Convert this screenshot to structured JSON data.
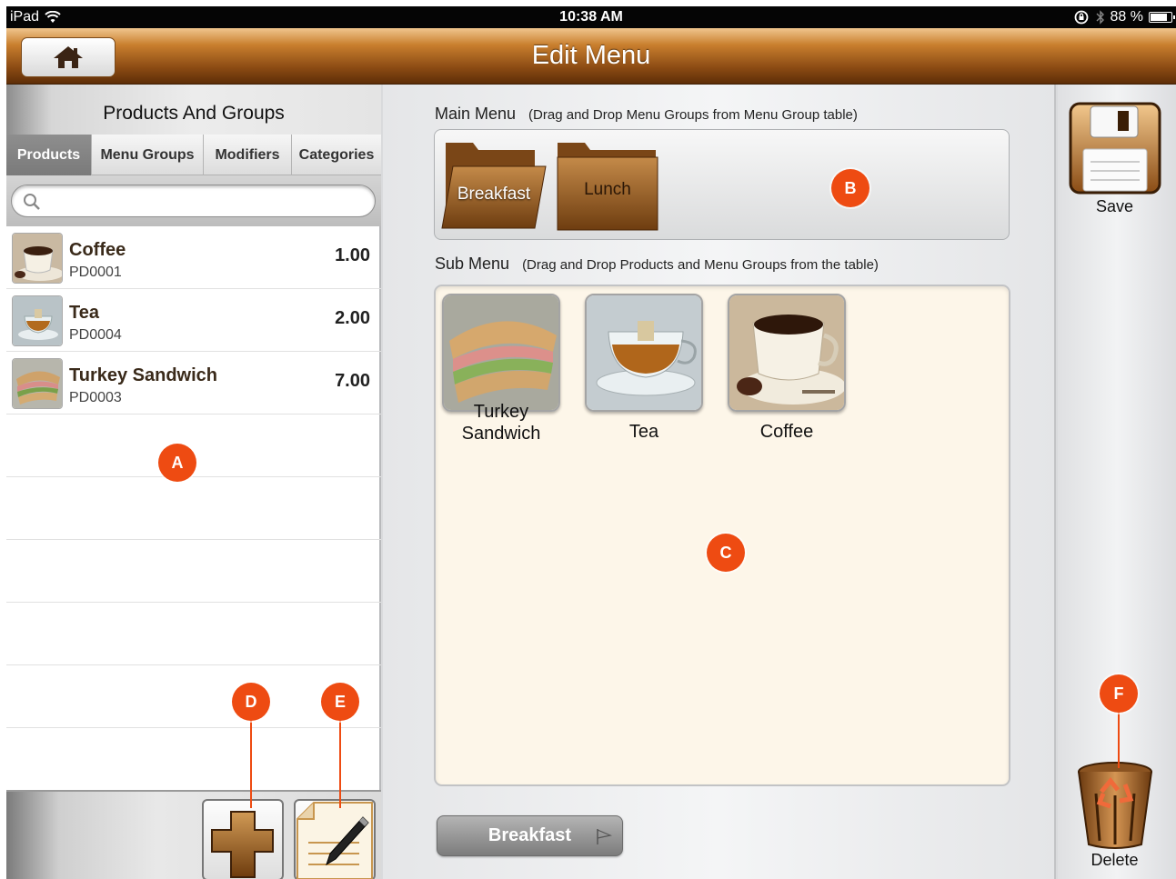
{
  "status_bar": {
    "device": "iPad",
    "time": "10:38 AM",
    "battery": "88 %",
    "battery_level": 0.88
  },
  "title_bar": {
    "title": "Edit Menu",
    "home_icon": "home-icon"
  },
  "left_panel": {
    "title": "Products And Groups",
    "tabs": [
      {
        "label": "Products",
        "active": true
      },
      {
        "label": "Menu Groups",
        "active": false
      },
      {
        "label": "Modifiers",
        "active": false
      },
      {
        "label": "Categories",
        "active": false
      }
    ],
    "search": {
      "placeholder": "",
      "value": ""
    },
    "products": [
      {
        "name": "Coffee",
        "code": "PD0001",
        "price": "1.00",
        "image": "coffee-image"
      },
      {
        "name": "Tea",
        "code": "PD0004",
        "price": "2.00",
        "image": "tea-image"
      },
      {
        "name": "Turkey Sandwich",
        "code": "PD0003",
        "price": "7.00",
        "image": "sandwich-image"
      }
    ],
    "add_icon": "plus-icon",
    "edit_icon": "edit-pen-icon"
  },
  "center_panel": {
    "main_menu_label": "Main Menu",
    "main_menu_hint": "(Drag and Drop Menu Groups from Menu Group table)",
    "main_menu_groups": [
      "Breakfast",
      "Lunch"
    ],
    "sub_menu_label": "Sub Menu",
    "sub_menu_hint": "(Drag and Drop Products and Menu Groups from the table)",
    "sub_menu_items": [
      {
        "name": "Turkey Sandwich",
        "image": "sandwich-image"
      },
      {
        "name": "Tea",
        "image": "tea-image"
      },
      {
        "name": "Coffee",
        "image": "coffee-image"
      }
    ],
    "breadcrumb": "Breakfast"
  },
  "right_panel": {
    "save_label": "Save",
    "delete_label": "Delete",
    "save_icon": "floppy-disk-icon",
    "delete_icon": "recycle-bin-icon"
  },
  "callouts": [
    "A",
    "B",
    "C",
    "D",
    "E",
    "F"
  ],
  "colors": {
    "accent_brown": "#8a4a13",
    "callout_orange": "#ee4b12",
    "submenu_bg": "#fdf6e9"
  }
}
